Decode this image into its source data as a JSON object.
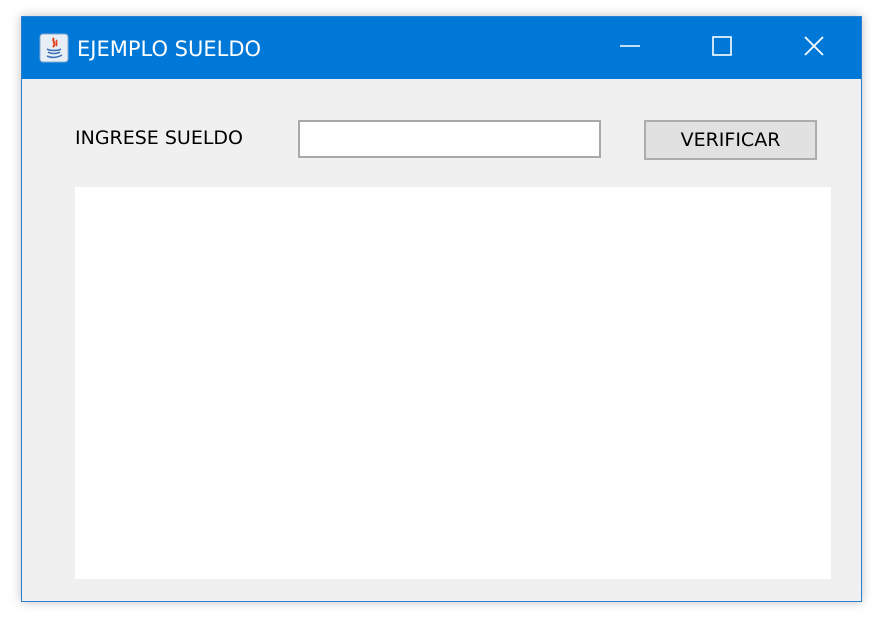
{
  "window": {
    "title": "EJEMPLO SUELDO",
    "accent_color": "#0078d7",
    "icons": {
      "app": "java-icon",
      "minimize": "minimize-icon",
      "maximize": "maximize-icon",
      "close": "close-icon"
    }
  },
  "form": {
    "sueldo_label": "INGRESE SUELDO",
    "sueldo_value": "",
    "verify_label": "VERIFICAR"
  },
  "output": {
    "text": ""
  }
}
